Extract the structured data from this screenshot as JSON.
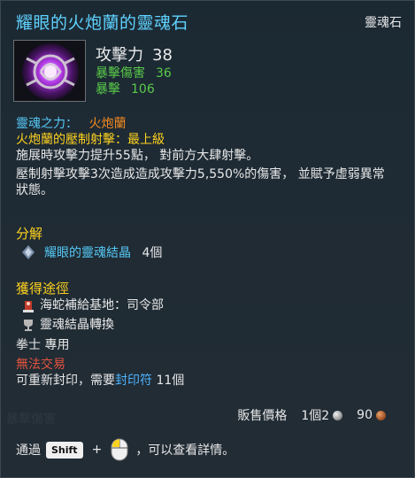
{
  "header": {
    "title": "耀眼的火炮蘭的靈魂石",
    "item_type": "靈魂石"
  },
  "stats": {
    "main_label": "攻擊力",
    "main_value": "38",
    "sub": [
      {
        "label": "暴擊傷害",
        "value": "36"
      },
      {
        "label": "暴擊",
        "value": "106"
      }
    ]
  },
  "soul": {
    "power_label": "靈魂之力：",
    "power_name": "火炮蘭",
    "skill_line": "火炮蘭的壓制射擊：最上級",
    "desc_1": "施展時攻擊力提升55點， 對前方大肆射擊。",
    "desc_2": "壓制射擊攻擊3次造成造成攻擊力5,550%的傷害， 並賦予虛弱異常",
    "desc_3": "狀態。"
  },
  "decompose": {
    "title": "分解",
    "item": "耀眼的靈魂結晶",
    "count": "4個"
  },
  "acquire": {
    "title": "獲得途徑",
    "items": [
      "海蛇補給基地：司令部",
      "靈魂結晶轉換"
    ]
  },
  "class_line": "拳士 專用",
  "trade_line": "無法交易",
  "reseal": {
    "prefix": "可重新封印，需要",
    "link": "封印符",
    "count": " 11個"
  },
  "price": {
    "label": "販售價格",
    "amount_1": "1個2",
    "amount_2": "90"
  },
  "hint": {
    "prefix": "通過",
    "key": "Shift",
    "plus": "+",
    "suffix": "，可以查看詳情。"
  },
  "background_ghost_text": "暴擊傷害",
  "colors": {
    "title": "#5fd2ff",
    "stat_green": "#59c94a",
    "accent_orange": "#f28a1e",
    "section_yellow": "#ffd21f",
    "warning_red": "#e4533f"
  }
}
